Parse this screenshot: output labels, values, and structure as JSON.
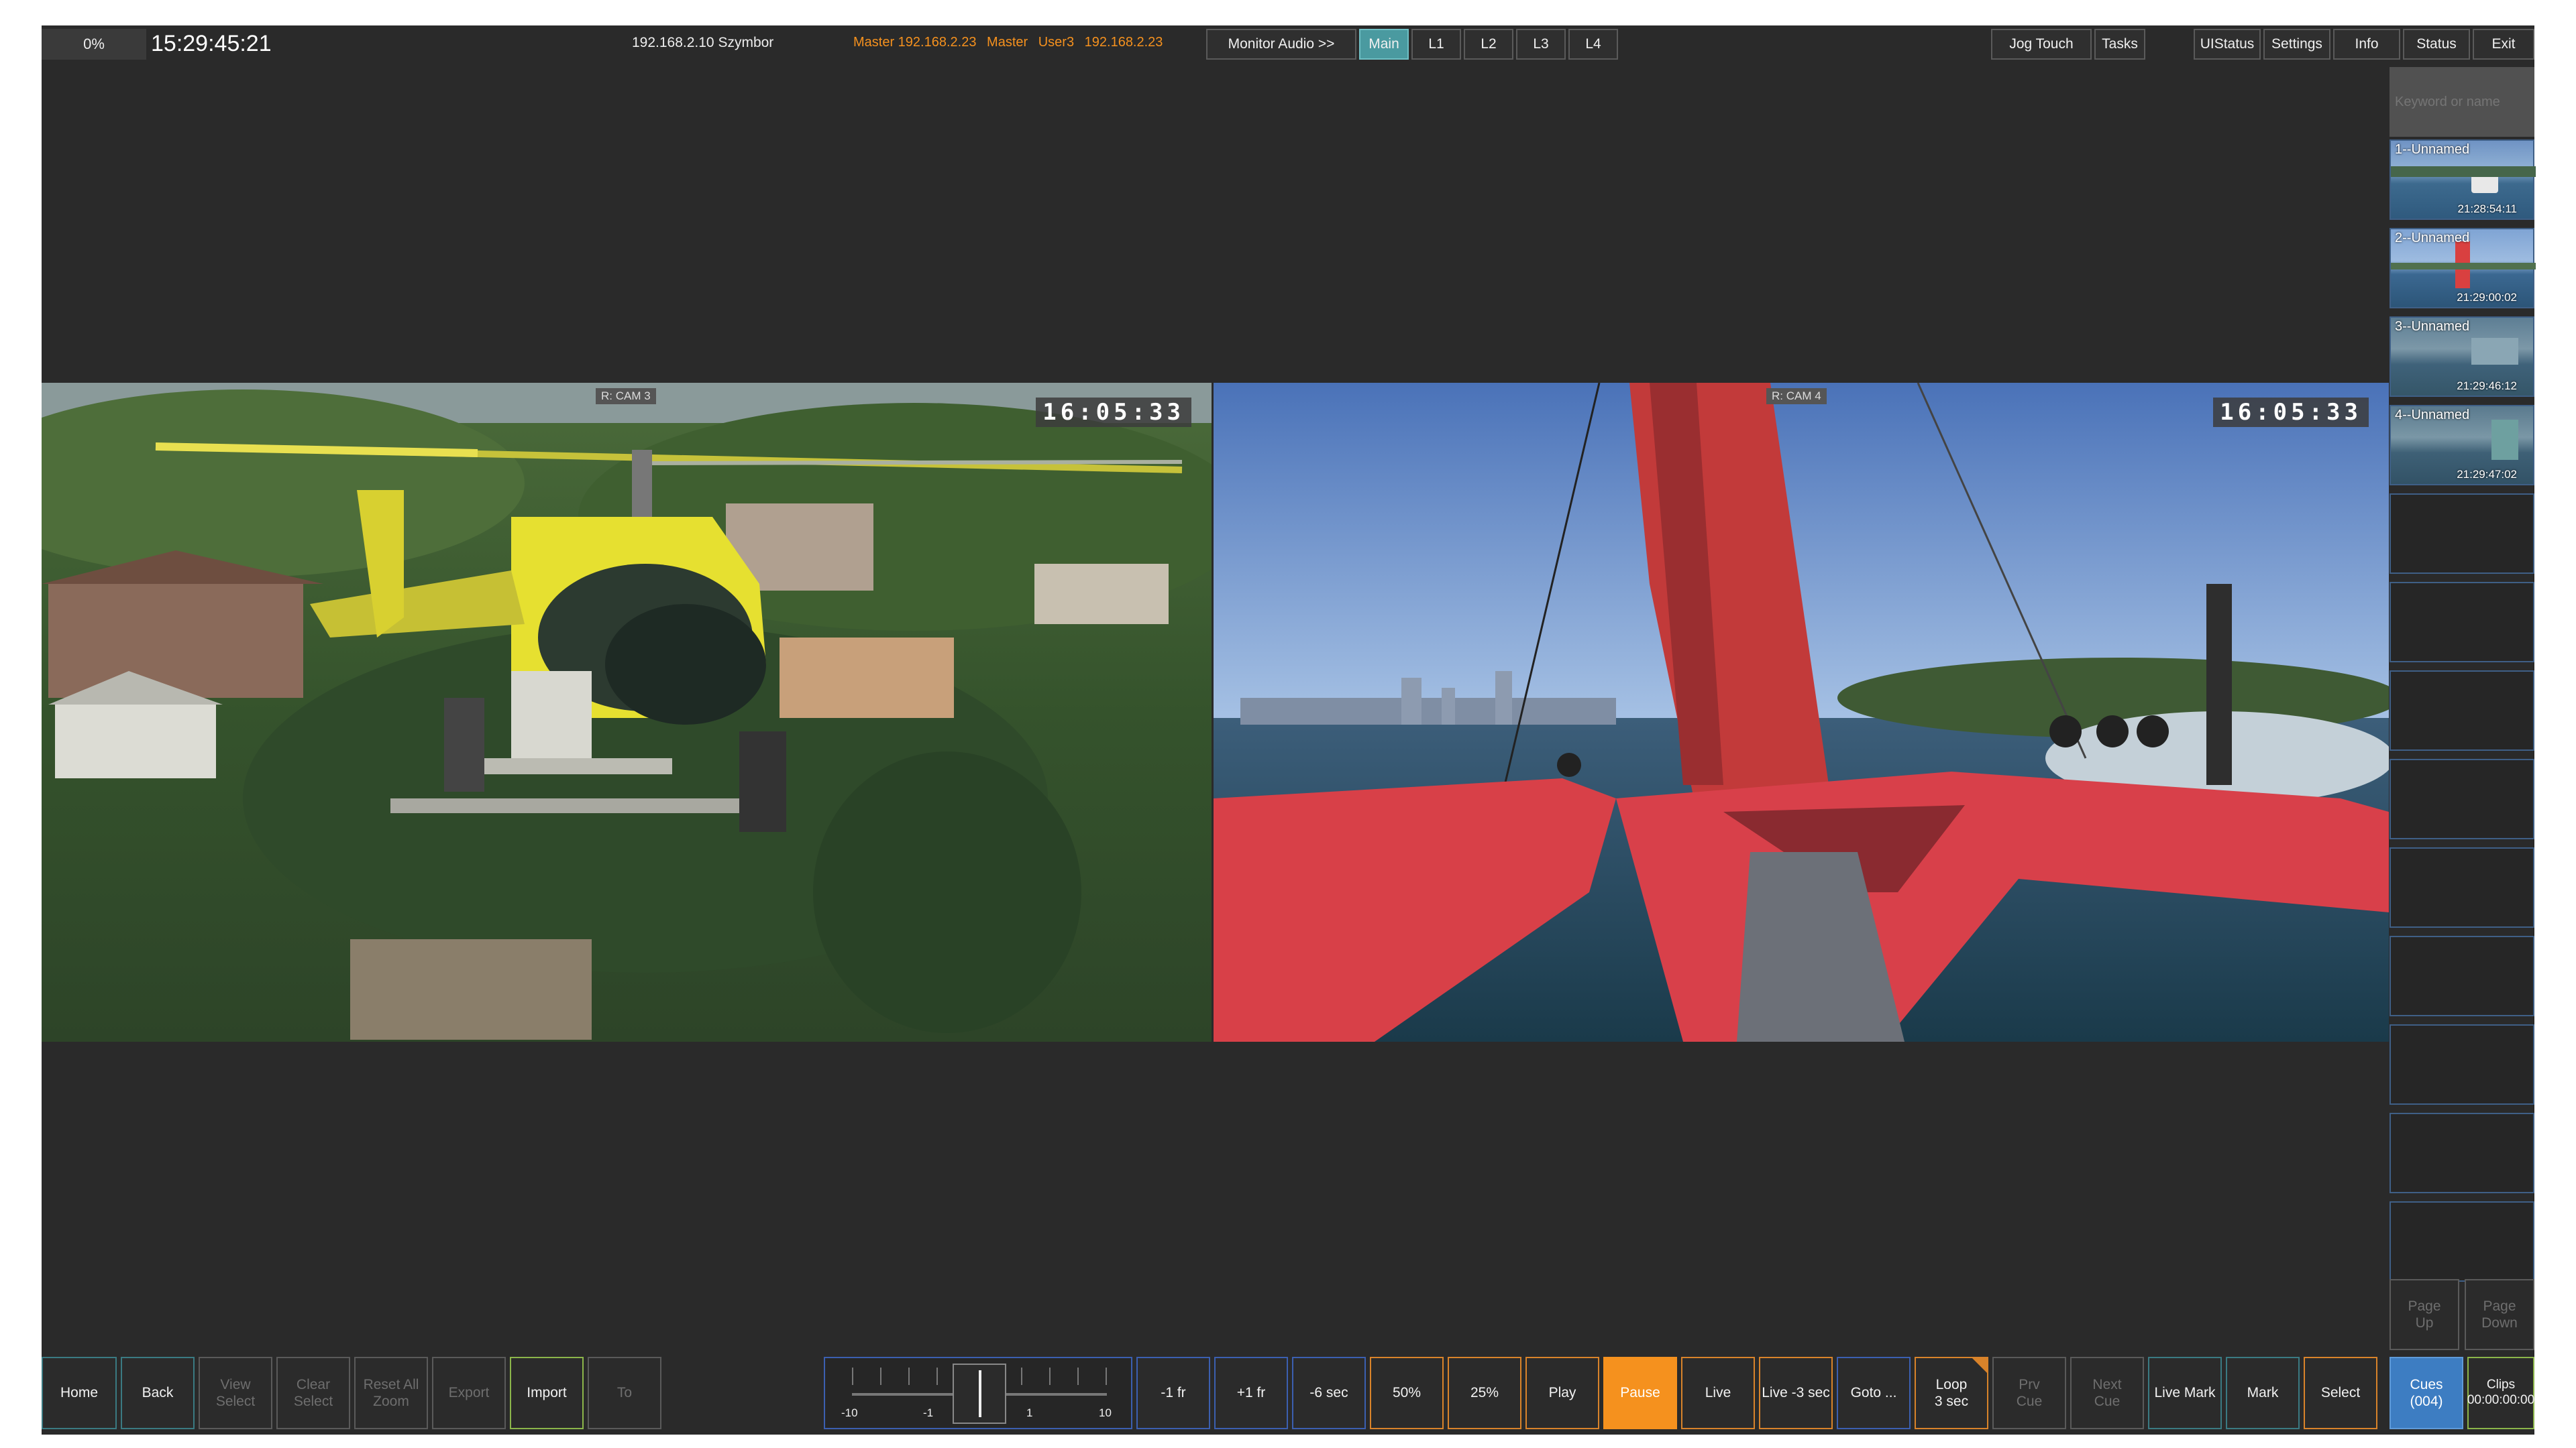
{
  "topbar": {
    "percent": "0%",
    "clock": "15:29:45:21",
    "server": "192.168.2.10 Szymbor",
    "status": {
      "master1": "Master 192.168.2.23",
      "master2": "Master",
      "user": "User3",
      "ip": "192.168.2.23"
    },
    "monitor_audio": "Monitor Audio >>",
    "tabs": [
      "Main",
      "L1",
      "L2",
      "L3",
      "L4"
    ],
    "right": [
      "Jog Touch",
      "Tasks",
      "UIStatus",
      "Settings",
      "Info",
      "Status",
      "Exit"
    ]
  },
  "search": {
    "placeholder": "Keyword or name"
  },
  "clips": [
    {
      "name": "1--Unnamed",
      "time": "21:28:54:11"
    },
    {
      "name": "2--Unnamed",
      "time": "21:29:00:02"
    },
    {
      "name": "3--Unnamed",
      "time": "21:29:46:12"
    },
    {
      "name": "4--Unnamed",
      "time": "21:29:47:02"
    }
  ],
  "viewers": [
    {
      "label": "R: CAM 3",
      "timecode": "16:05:33"
    },
    {
      "label": "R: CAM 4",
      "timecode": "16:05:33"
    }
  ],
  "page_buttons": {
    "up": "Page\nUp",
    "down": "Page\nDown"
  },
  "left_buttons": [
    {
      "label": "Home",
      "state": "normal"
    },
    {
      "label": "Back",
      "state": "normal"
    },
    {
      "label": "View\nSelect",
      "state": "disabled"
    },
    {
      "label": "Clear\nSelect",
      "state": "disabled"
    },
    {
      "label": "Reset All\nZoom",
      "state": "disabled"
    },
    {
      "label": "Export",
      "state": "disabled"
    },
    {
      "label": "Import",
      "state": "normal"
    },
    {
      "label": "To",
      "state": "disabled"
    }
  ],
  "jog": {
    "ticks": [
      "-10",
      "-1",
      "1",
      "10"
    ]
  },
  "transport_buttons": [
    {
      "label": "-1 fr"
    },
    {
      "label": "+1 fr"
    },
    {
      "label": "-6 sec"
    },
    {
      "label": "50%"
    },
    {
      "label": "25%"
    },
    {
      "label": "Play"
    },
    {
      "label": "Pause"
    },
    {
      "label": "Live"
    },
    {
      "label": "Live -3 sec"
    },
    {
      "label": "Goto ..."
    },
    {
      "label": "Loop\n3 sec"
    },
    {
      "label": "Prv\nCue"
    },
    {
      "label": "Next\nCue"
    },
    {
      "label": "Live Mark"
    },
    {
      "label": "Mark"
    },
    {
      "label": "Select"
    },
    {
      "label": "Cues\n(004)"
    },
    {
      "label": "Clips\n00:00:00:00"
    }
  ],
  "colors": {
    "accent_orange": "#f5911e",
    "active_tab": "#4a9aa0",
    "cues_blue": "#3d7dc2"
  }
}
